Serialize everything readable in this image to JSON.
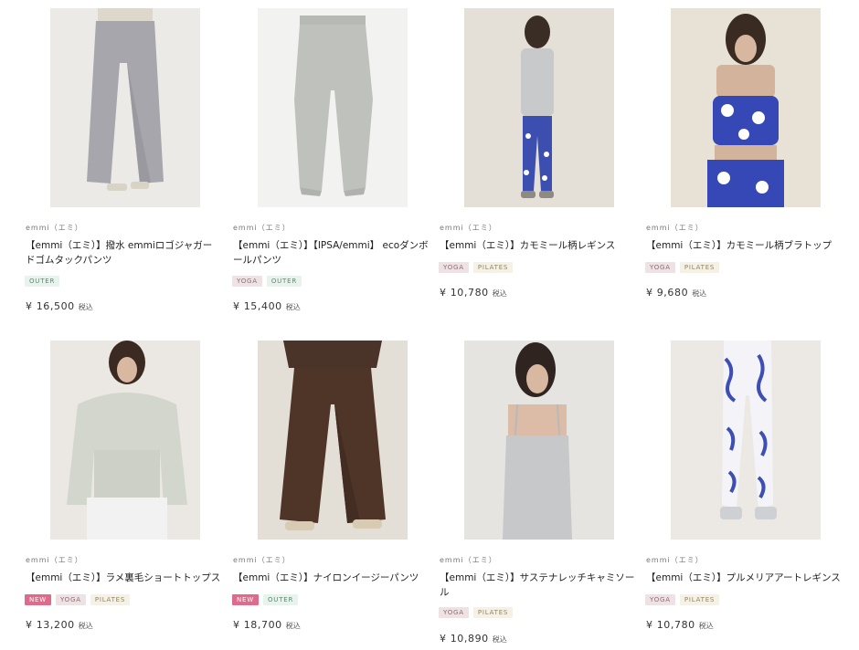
{
  "products": [
    {
      "brand": "emmi（エミ）",
      "name": "【emmi（エミ）】撥水 emmiロゴジャガードゴムタックパンツ",
      "tags": [
        {
          "label": "OUTER"
        }
      ],
      "price": "¥ 16,500",
      "tax": "税込",
      "image": "gray-wide-pants-photo"
    },
    {
      "brand": "emmi（エミ）",
      "name": "【emmi（エミ）】【IPSA/emmi】 ecoダンボールパンツ",
      "tags": [
        {
          "label": "YOGA"
        },
        {
          "label": "OUTER"
        }
      ],
      "price": "¥ 15,400",
      "tax": "税込",
      "image": "light-gray-jogger-photo"
    },
    {
      "brand": "emmi（エミ）",
      "name": "【emmi（エミ）】カモミール柄レギンス",
      "tags": [
        {
          "label": "YOGA"
        },
        {
          "label": "PILATES"
        }
      ],
      "price": "¥ 10,780",
      "tax": "税込",
      "image": "blue-floral-leggings-photo"
    },
    {
      "brand": "emmi（エミ）",
      "name": "【emmi（エミ）】カモミール柄ブラトップ",
      "tags": [
        {
          "label": "YOGA"
        },
        {
          "label": "PILATES"
        }
      ],
      "price": "¥ 9,680",
      "tax": "税込",
      "image": "blue-floral-bratop-photo"
    },
    {
      "brand": "emmi（エミ）",
      "name": "【emmi（エミ）】ラメ裏毛ショートトップス",
      "tags": [
        {
          "label": "NEW"
        },
        {
          "label": "YOGA"
        },
        {
          "label": "PILATES"
        }
      ],
      "price": "¥ 13,200",
      "tax": "税込",
      "image": "mint-sweatshirt-photo"
    },
    {
      "brand": "emmi（エミ）",
      "name": "【emmi（エミ）】ナイロンイージーパンツ",
      "tags": [
        {
          "label": "NEW"
        },
        {
          "label": "OUTER"
        }
      ],
      "price": "¥ 18,700",
      "tax": "税込",
      "image": "brown-nylon-pants-photo"
    },
    {
      "brand": "emmi（エミ）",
      "name": "【emmi（エミ）】サステナレッチキャミソール",
      "tags": [
        {
          "label": "YOGA"
        },
        {
          "label": "PILATES"
        }
      ],
      "price": "¥ 10,890",
      "tax": "税込",
      "image": "gray-camisole-photo"
    },
    {
      "brand": "emmi（エミ）",
      "name": "【emmi（エミ）】プルメリアアートレギンス",
      "tags": [
        {
          "label": "YOGA"
        },
        {
          "label": "PILATES"
        }
      ],
      "price": "¥ 10,780",
      "tax": "税込",
      "image": "blue-pattern-leggings-photo"
    }
  ]
}
